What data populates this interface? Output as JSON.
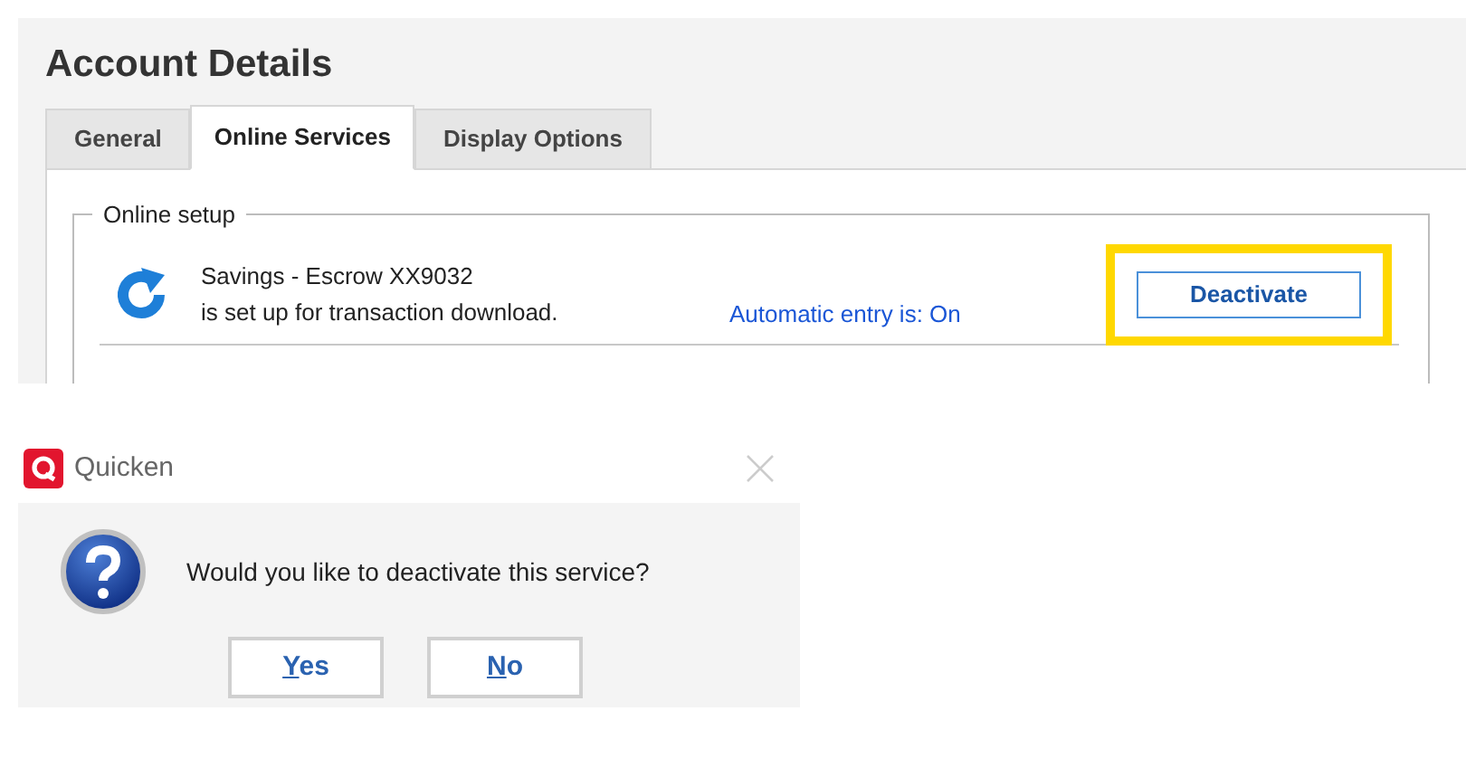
{
  "window": {
    "title": "Account Details"
  },
  "tabs": [
    {
      "label": "General",
      "selected": false
    },
    {
      "label": "Online Services",
      "selected": true
    },
    {
      "label": "Display Options",
      "selected": false
    }
  ],
  "online_setup": {
    "legend": "Online setup",
    "account": "Savings - Escrow XX9032",
    "status": "is set up for transaction download.",
    "automatic_entry": "Automatic entry is: On",
    "button": {
      "label": "Deactivate",
      "highlighted": true
    }
  },
  "dialog": {
    "title": "Quicken",
    "message": "Would you like to deactivate this service?",
    "buttons": [
      {
        "label": "Yes",
        "first_letter_underlined": true
      },
      {
        "label": "No",
        "first_letter_underlined": true
      }
    ]
  }
}
